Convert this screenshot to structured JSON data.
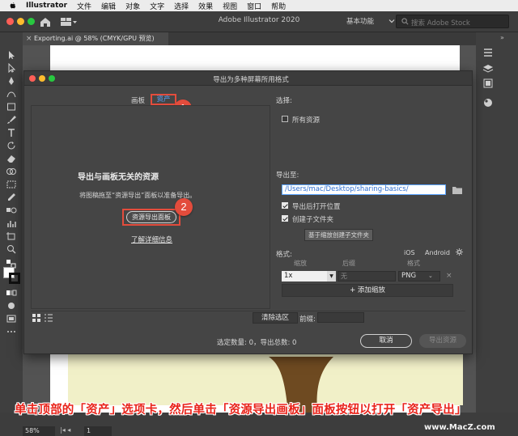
{
  "menubar": {
    "app_name": "Illustrator",
    "items": [
      "文件",
      "编辑",
      "对象",
      "文字",
      "选择",
      "效果",
      "视图",
      "窗口",
      "帮助"
    ]
  },
  "appbar": {
    "title": "Adobe Illustrator 2020",
    "workspace": "基本功能",
    "search_placeholder": "搜索 Adobe Stock"
  },
  "document": {
    "tab_label": "Exporting.ai @ 58% (CMYK/GPU 预览)",
    "close_glyph": "×"
  },
  "status": {
    "zoom": "58%",
    "artboard_nav": "|◂ ◂",
    "page": "1"
  },
  "dialog": {
    "title": "导出为多种屏幕所用格式",
    "tabs": {
      "artboard": "画板",
      "assets": "资产"
    },
    "empty_title": "导出与画板无关的资源",
    "empty_desc": "将图稿拖至“资源导出”面板以准备导出。",
    "export_panel_button": "资源导出面板",
    "learn_more": "了解详细信息",
    "select_label": "选择:",
    "all_assets": "所有资源",
    "all_assets_checked": false,
    "export_to_label": "导出至:",
    "export_path": "/Users/mac/Desktop/sharing-basics/",
    "open_after_export": "导出后打开位置",
    "open_after_export_checked": true,
    "create_subfolders": "创建子文件夹",
    "create_subfolders_checked": true,
    "tooltip": "基于缩放创建子文件夹",
    "format_label": "格式:",
    "preset_ios": "iOS",
    "preset_android": "Android",
    "columns": {
      "scale": "缩放",
      "suffix": "后缀",
      "format": "格式"
    },
    "row": {
      "scale": "1x",
      "suffix_placeholder": "无",
      "format": "PNG"
    },
    "add_scale": "+ 添加缩放",
    "clear_selection": "清除选区",
    "prefix_label": "前缀:",
    "prefix_value": "",
    "summary": "选定数量: 0，导出总数: 0",
    "cancel": "取消",
    "export": "导出资源"
  },
  "badges": {
    "one": "1",
    "two": "2"
  },
  "caption": "单击顶部的「资产」选项卡，然后单击「资源导出画板」面板按钮以打开「资产导出」",
  "watermark": "www.MacZ.com",
  "colors": {
    "highlight": "#e34c3c",
    "accent": "#5aa3ff",
    "caption": "#e9231a"
  }
}
